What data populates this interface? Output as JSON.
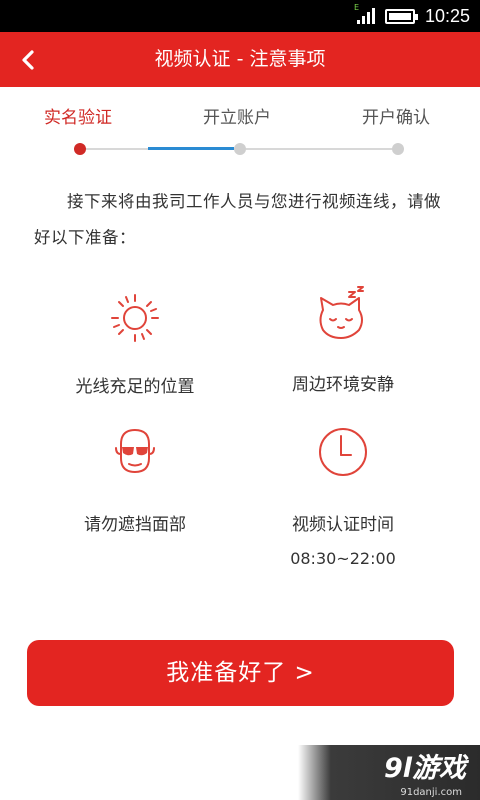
{
  "status_bar": {
    "time": "10:25",
    "network_label": "E"
  },
  "header": {
    "title": "视频认证 - 注意事项",
    "back_icon": "back-chevron-icon"
  },
  "steps": [
    {
      "label": "实名验证",
      "active": true
    },
    {
      "label": "开立账户",
      "active": false
    },
    {
      "label": "开户确认",
      "active": false
    }
  ],
  "intro_text": "接下来将由我司工作人员与您进行视频连线，请做好以下准备：",
  "tips": [
    {
      "icon": "sun-icon",
      "label": "光线充足的位置"
    },
    {
      "icon": "sleeping-cat-icon",
      "label": "周边环境安静"
    },
    {
      "icon": "sunglasses-face-icon",
      "label": "请勿遮挡面部"
    },
    {
      "icon": "clock-icon",
      "label": "视频认证时间",
      "sub": "08:30~22:00"
    }
  ],
  "ready_button": {
    "label": "我准备好了 >"
  },
  "watermark": {
    "brand": "9l游戏",
    "url": "91danji.com"
  },
  "colors": {
    "primary": "#e32521",
    "progress_blue": "#2a8bd3",
    "icon_red": "#e0443a"
  }
}
